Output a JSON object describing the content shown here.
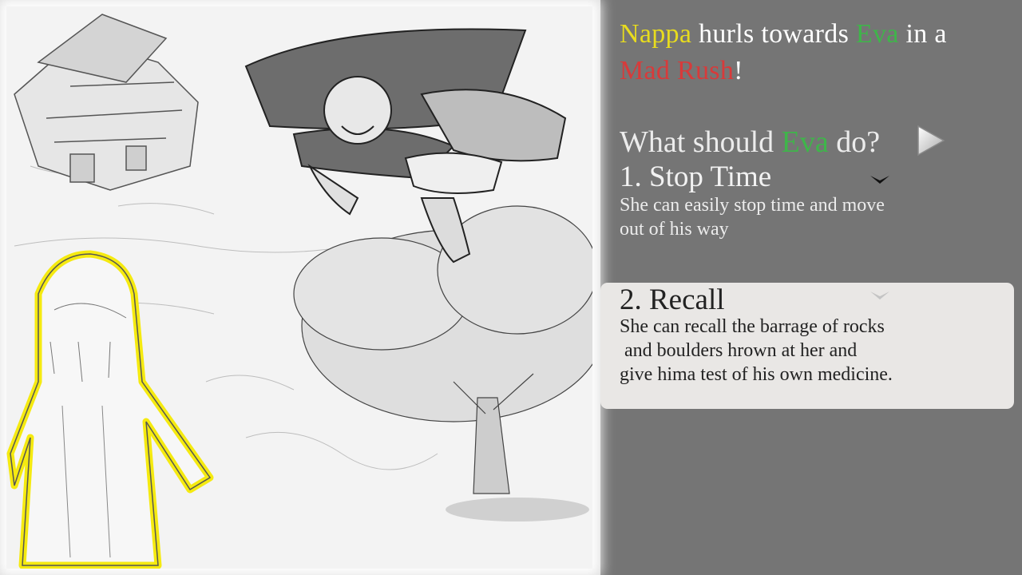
{
  "narration": {
    "attacker": "Nappa",
    "text_1": " hurls towards ",
    "target": "Eva",
    "text_2": " in a",
    "move": "Mad Rush",
    "text_3": "!"
  },
  "prompt": {
    "text_1": "What should ",
    "name": "Eva",
    "text_2": " do?"
  },
  "choices": [
    {
      "title": "1. Stop Time",
      "description": "She can easily stop time and move\nout of his way",
      "chevron_icon": "chevron-down-icon"
    },
    {
      "title": "2. Recall",
      "description": "She can recall the barrage of rocks\n and boulders hrown at her and\ngive hima test of his own medicine.",
      "chevron_icon": "chevron-down-icon"
    }
  ],
  "next_icon": "play-triangle-icon",
  "colors": {
    "attacker": "#e8dc1e",
    "target": "#3fb54a",
    "move": "#d83a3a",
    "background": "#757575",
    "selected_choice_bg": "#e9e7e5",
    "character_outline": "#f5ea10"
  }
}
